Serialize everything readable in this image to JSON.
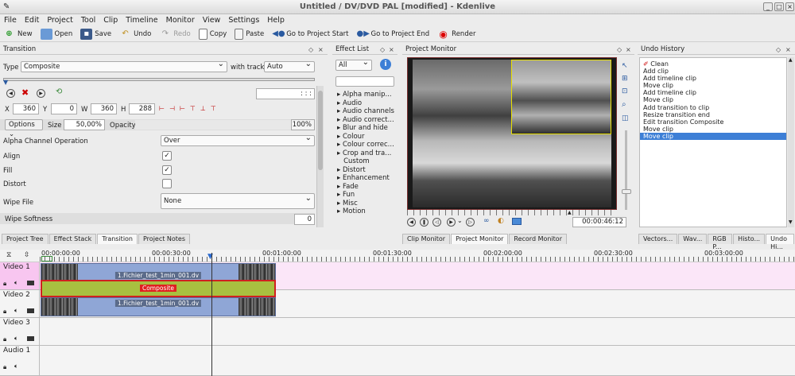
{
  "window": {
    "title": "Untitled / DV/DVD PAL [modified] - Kdenlive"
  },
  "menu": [
    "File",
    "Edit",
    "Project",
    "Tool",
    "Clip",
    "Timeline",
    "Monitor",
    "View",
    "Settings",
    "Help"
  ],
  "toolbar": {
    "new": "New",
    "open": "Open",
    "save": "Save",
    "undo": "Undo",
    "redo": "Redo",
    "copy": "Copy",
    "paste": "Paste",
    "go_start": "Go to Project Start",
    "go_end": "Go to Project End",
    "render": "Render"
  },
  "transition": {
    "panel_title": "Transition",
    "type_label": "Type",
    "type_value": "Composite",
    "with_track_label": "with track",
    "with_track_value": "Auto",
    "timecode": ": : :",
    "x_label": "X",
    "x_value": "360",
    "y_label": "Y",
    "y_value": "0",
    "w_label": "W",
    "w_value": "360",
    "h_label": "H",
    "h_value": "288",
    "options_label": "Options",
    "size_label": "Size",
    "size_value": "50,00%",
    "opacity_label": "Opacity",
    "opacity_value": "100%",
    "alpha_label": "Alpha Channel Operation",
    "alpha_value": "Over",
    "align_label": "Align",
    "fill_label": "Fill",
    "distort_label": "Distort",
    "wipe_label": "Wipe File",
    "wipe_value": "None",
    "softness_label": "Wipe Softness",
    "softness_value": "0"
  },
  "left_tabs": [
    "Project Tree",
    "Effect Stack",
    "Transition",
    "Project Notes"
  ],
  "effects": {
    "panel_title": "Effect List",
    "filter": "All",
    "items": [
      "Alpha manip...",
      "Audio",
      "Audio channels",
      "Audio correct...",
      "Blur and hide",
      "Colour",
      "Colour correc...",
      "Crop and tra...",
      "Custom",
      "Distort",
      "Enhancement",
      "Fade",
      "Fun",
      "Misc",
      "Motion"
    ]
  },
  "monitor": {
    "panel_title": "Project Monitor",
    "timecode": "00:00:46:12"
  },
  "monitor_tabs": [
    "Clip Monitor",
    "Project Monitor",
    "Record Monitor"
  ],
  "undo": {
    "panel_title": "Undo History",
    "items": [
      "Clean",
      "Add clip",
      "Add timeline clip",
      "Move clip",
      "Add timeline clip",
      "Move clip",
      "Add transition to clip",
      "Resize transition end",
      "Edit transition Composite",
      "Move clip",
      "Move clip"
    ]
  },
  "right_tabs": [
    "Vectors...",
    "Wav...",
    "RGB P...",
    "Histo...",
    "Undo Hi..."
  ],
  "timeline": {
    "ticks": [
      "00:00:00:00",
      "00:00:30:00",
      "00:01:00:00",
      "00:01:30:00",
      "00:02:00:00",
      "00:02:30:00",
      "00:03:00:00"
    ],
    "tracks": [
      "Video 1",
      "Video 2",
      "Video 3",
      "Audio 1"
    ],
    "clip1_name": "1.Fichier_test_1min_001.dv",
    "clip2_name": "1.Fichier_test_1min_001.dv",
    "transition_name": "Composite"
  },
  "colors": {
    "accent": "#3d7fd6",
    "video1_bg": "#fbe6f8",
    "transition": "#a8c040",
    "clip": "#8fa6d6"
  }
}
